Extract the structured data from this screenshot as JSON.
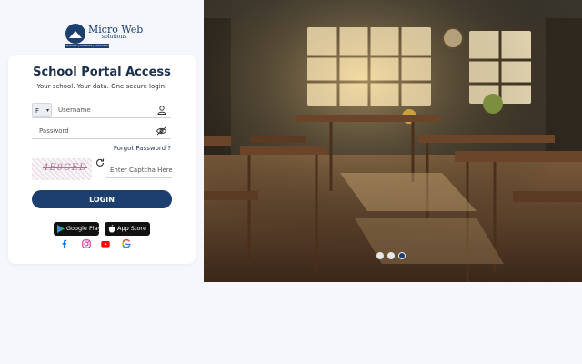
{
  "brand": {
    "name": "Micro Web",
    "subname": "solutions",
    "tagline": "SCHOOL | COLLEGE | UNIVERSITY ERP"
  },
  "login": {
    "title": "School Portal Access",
    "subtitle": "Your school. Your data. One secure login.",
    "country_code": "F",
    "username_placeholder": "Username",
    "password_placeholder": "Password",
    "forgot_label": "Forgot Password ?",
    "captcha_text": "4E0CED",
    "captcha_placeholder": "Enter Captcha Here",
    "login_label": "LOGIN"
  },
  "stores": {
    "google_play": "Google Play",
    "app_store": "App Store"
  },
  "social": [
    "facebook-icon",
    "instagram-icon",
    "youtube-icon",
    "google-icon"
  ],
  "carousel": {
    "slide_count": 3,
    "active_index": 2
  },
  "colors": {
    "primary": "#1c3f70",
    "background": "#f5f7fd",
    "card": "#ffffff"
  }
}
